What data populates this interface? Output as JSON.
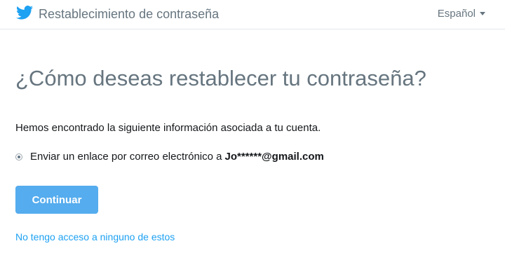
{
  "header": {
    "title": "Restablecimiento de contraseña",
    "logo_icon": "twitter-bird-icon",
    "language": "Español",
    "language_icon": "chevron-down-icon",
    "brand_color": "#1DA1F2",
    "border_color": "#E1E8ED"
  },
  "main": {
    "title": "¿Cómo deseas restablecer tu contraseña?",
    "info_text": "Hemos encontrado la siguiente información asociada a tu cuenta.",
    "option": {
      "label": "Enviar un enlace por correo electrónico a",
      "email": "Jo******@gmail.com",
      "selected": true
    },
    "continue_button": {
      "label": "Continuar",
      "color": "#55ACEE"
    },
    "no_access_link": "No tengo acceso a ninguno de estos"
  }
}
